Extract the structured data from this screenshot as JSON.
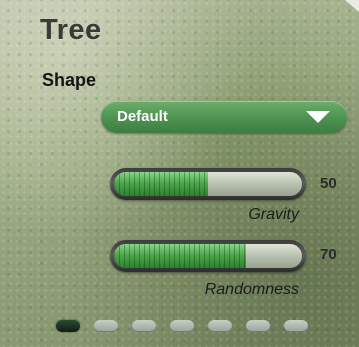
{
  "panel": {
    "title": "Tree",
    "section_label": "Shape"
  },
  "shape_dropdown": {
    "selected": "Default",
    "icon": "triangle-down-icon"
  },
  "sliders": [
    {
      "caption": "Gravity",
      "value": "50",
      "fill_percent": 50
    },
    {
      "caption": "Randomness",
      "value": "70",
      "fill_percent": 70
    }
  ],
  "pagination": {
    "page_count": 7,
    "active_index": 0
  },
  "colors": {
    "accent_green": "#4d9250",
    "slider_fill_green": "#4ea84e",
    "title_text": "#3a3a36"
  }
}
